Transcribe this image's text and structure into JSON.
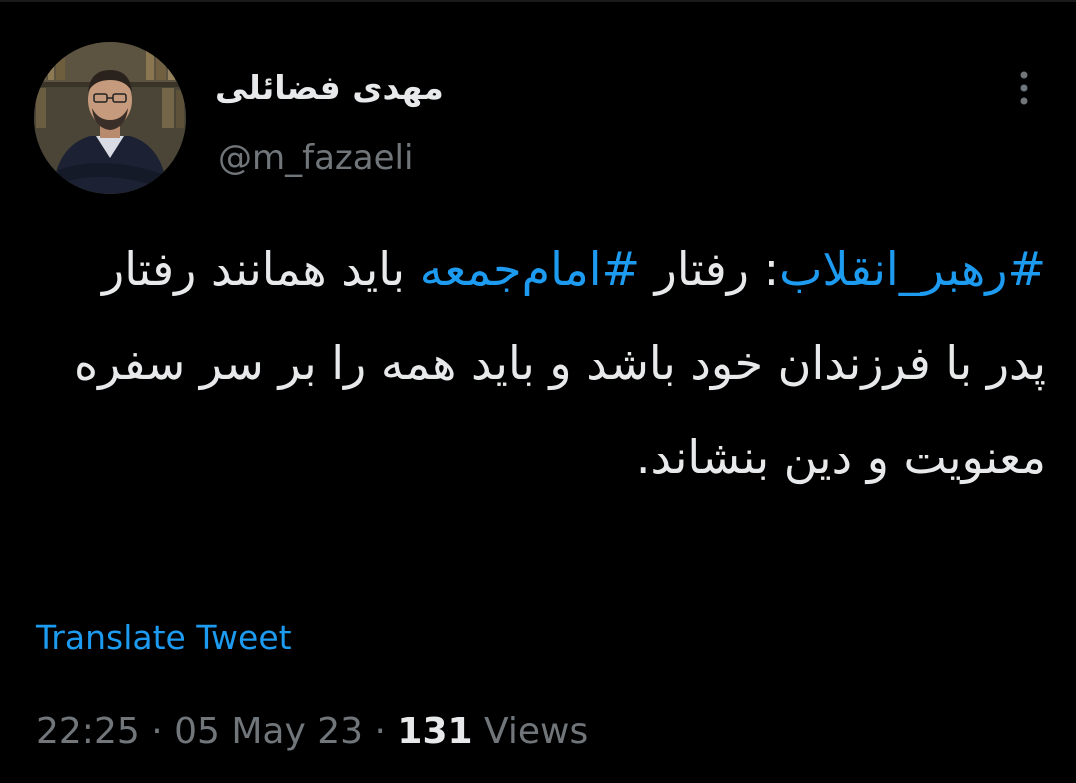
{
  "tweet": {
    "author": {
      "display_name": "مهدی فضائلی",
      "handle": "@m_fazaeli",
      "avatar_icon": "profile-photo"
    },
    "more_icon": "more-dots-vertical-icon",
    "text_segments": [
      {
        "text": "#رهبر_انقلاب",
        "type": "hashtag"
      },
      {
        "text": ": رفتار ",
        "type": "text"
      },
      {
        "text": "#امام‌جمعه",
        "type": "hashtag"
      },
      {
        "text": " باید همانند رفتار پدر با فرزندان خود باشد و باید همه را بر سر سفره معنویت و دین بنشاند.",
        "type": "text"
      }
    ],
    "translate_label": "Translate Tweet",
    "time": "22:25",
    "date": "05 May 23",
    "separator": "·",
    "views_count": "131",
    "views_label": "Views"
  },
  "colors": {
    "background": "#000000",
    "text": "#e7e9ea",
    "muted": "#71767b",
    "accent": "#1d9bf0"
  }
}
